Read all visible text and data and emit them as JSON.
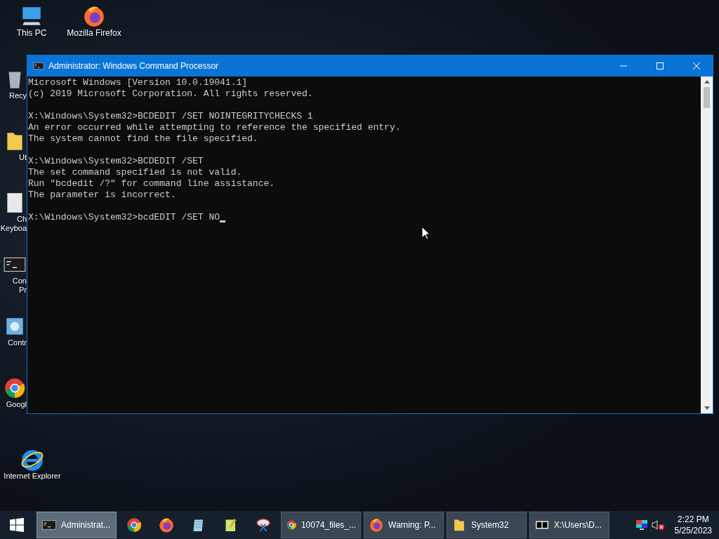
{
  "desktop_icons": [
    {
      "kind": "pc",
      "label_lines": [
        "This PC"
      ]
    },
    {
      "kind": "firefox",
      "label_lines": [
        "Mozilla Firefox"
      ]
    }
  ],
  "desktop_column": [
    {
      "kind": "recycle",
      "label_lines": [
        "Recy"
      ]
    },
    {
      "kind": "folder",
      "label_lines": [
        "Ut"
      ]
    },
    {
      "kind": "keyboard",
      "label_lines": [
        "Ch",
        "Keyboa"
      ]
    },
    {
      "kind": "cmd",
      "label_lines": [
        "Con",
        "Pr"
      ]
    },
    {
      "kind": "control",
      "label_lines": [
        "Contr"
      ]
    },
    {
      "kind": "chrome",
      "label_lines": [
        "Googl"
      ]
    },
    {
      "kind": "ie",
      "label_lines": [
        "Internet Explorer"
      ]
    }
  ],
  "window": {
    "title": "Administrator: Windows Command Processor",
    "blocks": [
      [
        "Microsoft Windows [Version 10.0.19041.1]",
        "(c) 2019 Microsoft Corporation. All rights reserved."
      ],
      [
        "X:\\Windows\\System32>BCDEDIT /SET NOINTEGRITYCHECKS 1",
        "An error occurred while attempting to reference the specified entry.",
        "The system cannot find the file specified."
      ],
      [
        "X:\\Windows\\System32>BCDEDIT /SET",
        "The set command specified is not valid.",
        "Run \"bcdedit /?\" for command line assistance.",
        "The parameter is incorrect."
      ]
    ],
    "input": "X:\\Windows\\System32>bcdEDIT /SET NO"
  },
  "taskbar": {
    "items": [
      {
        "kind": "cmd",
        "label": "Administrat...",
        "selected": true
      },
      {
        "kind": "chrome",
        "selected": false
      },
      {
        "kind": "firefox",
        "selected": false
      },
      {
        "kind": "notepad",
        "selected": false
      },
      {
        "kind": "notepadpp",
        "selected": false
      },
      {
        "kind": "snip",
        "selected": false
      },
      {
        "kind": "chrome",
        "label": "10074_files_...",
        "selected": false
      },
      {
        "kind": "firefox",
        "label": "Warning: P...",
        "selected": false
      },
      {
        "kind": "folder",
        "label": "System32",
        "selected": false
      },
      {
        "kind": "zip",
        "label": "X:\\Users\\D...",
        "selected": false
      }
    ],
    "time": "2:22 PM",
    "date": "5/25/2023"
  }
}
